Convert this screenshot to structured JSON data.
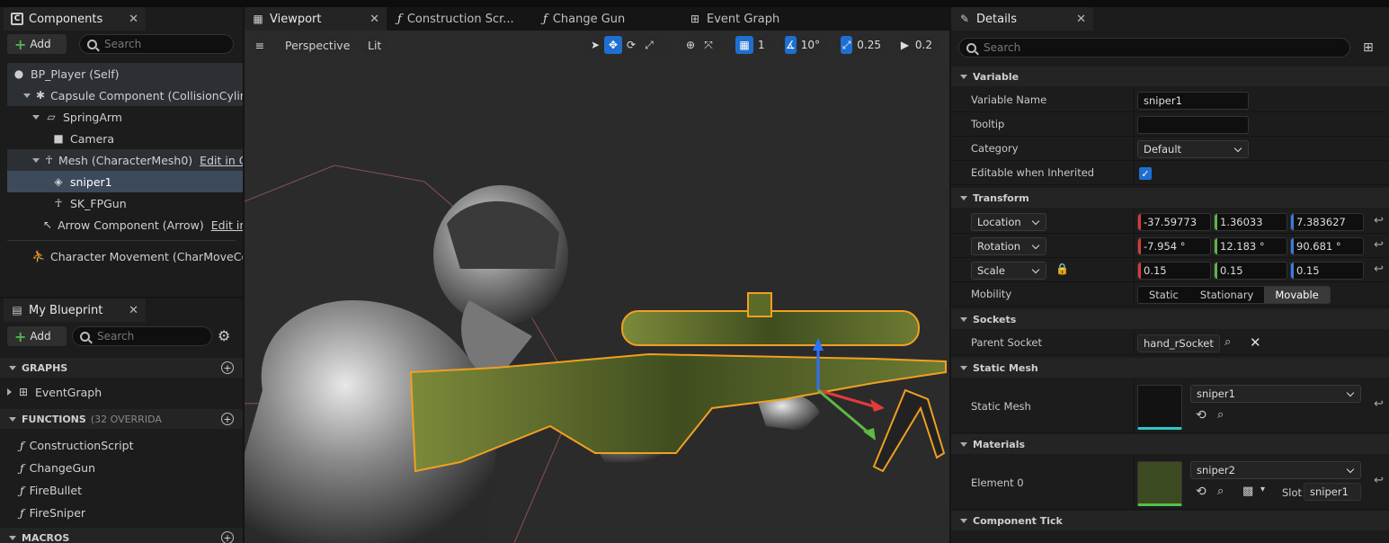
{
  "components_panel": {
    "tab_label": "Components",
    "add_label": "Add",
    "search_placeholder": "Search",
    "tree": [
      {
        "label": "BP_Player (Self)",
        "link": ""
      },
      {
        "label": "Capsule Component (CollisionCylinder)",
        "link": ""
      },
      {
        "label": "SpringArm",
        "link": ""
      },
      {
        "label": "Camera",
        "link": ""
      },
      {
        "label": "Mesh (CharacterMesh0)",
        "link": "Edit in C++"
      },
      {
        "label": "sniper1",
        "link": ""
      },
      {
        "label": "SK_FPGun",
        "link": ""
      },
      {
        "label": "Arrow Component (Arrow)",
        "link": "Edit in C++"
      },
      {
        "label": "Character Movement (CharMoveComp)",
        "link": ""
      }
    ]
  },
  "blueprint_panel": {
    "tab_label": "My Blueprint",
    "add_label": "Add",
    "search_placeholder": "Search",
    "graphs_header": "GRAPHS",
    "event_graph": "EventGraph",
    "functions_header": "FUNCTIONS",
    "functions_count": "(32 OVERRIDA",
    "functions": [
      "ConstructionScript",
      "ChangeGun",
      "FireBullet",
      "FireSniper"
    ],
    "macros_header": "MACROS"
  },
  "editor_tabs": [
    {
      "label": "Viewport"
    },
    {
      "label": "Construction Scr..."
    },
    {
      "label": "Change Gun"
    },
    {
      "label": "Event Graph"
    }
  ],
  "viewport": {
    "perspective_label": "Perspective",
    "lit_label": "Lit",
    "grid_snap": "1",
    "rotation_snap": "10°",
    "scale_snap": "0.25",
    "camera_speed": "0.2"
  },
  "details": {
    "tab_label": "Details",
    "search_placeholder": "Search",
    "variable_header": "Variable",
    "variable_name_label": "Variable Name",
    "variable_name_value": "sniper1",
    "tooltip_label": "Tooltip",
    "tooltip_value": "",
    "category_label": "Category",
    "category_value": "Default",
    "editable_label": "Editable when Inherited",
    "transform_header": "Transform",
    "location_label": "Location",
    "location": [
      "-37.59773",
      "1.36033",
      "7.383627"
    ],
    "rotation_label": "Rotation",
    "rotation": [
      "-7.954 °",
      "12.183 °",
      "90.681 °"
    ],
    "scale_label": "Scale",
    "scale": [
      "0.15",
      "0.15",
      "0.15"
    ],
    "mobility_label": "Mobility",
    "mobility_options": [
      "Static",
      "Stationary",
      "Movable"
    ],
    "sockets_header": "Sockets",
    "parent_socket_label": "Parent Socket",
    "parent_socket_value": "hand_rSocket",
    "static_mesh_header": "Static Mesh",
    "static_mesh_label": "Static Mesh",
    "static_mesh_value": "sniper1",
    "materials_header": "Materials",
    "element_label": "Element 0",
    "element_value": "sniper2",
    "slot_label": "Slot",
    "slot_value": "sniper1",
    "component_tick_header": "Component Tick"
  },
  "colors": {
    "accent_blue": "#1f6fd1",
    "selection": "#3d4a5c",
    "outline_orange": "#f0a020"
  }
}
